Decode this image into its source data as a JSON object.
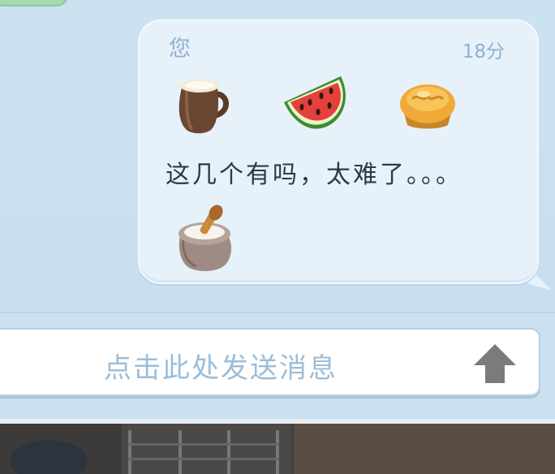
{
  "message": {
    "sender": "您",
    "time": "18分",
    "items": [
      {
        "name": "milk-jug-icon"
      },
      {
        "name": "watermelon-slice-icon"
      },
      {
        "name": "cupcake-icon"
      },
      {
        "name": "flour-sack-icon"
      }
    ],
    "text": "这几个有吗，太难了。。。"
  },
  "input": {
    "placeholder": "点击此处发送消息",
    "send_icon": "up-arrow-icon"
  },
  "colors": {
    "bubble": "#e7f1fa",
    "meta_text": "#8fb1cf",
    "placeholder_text": "#9bbdd8",
    "send_arrow": "#7b7b7b"
  }
}
